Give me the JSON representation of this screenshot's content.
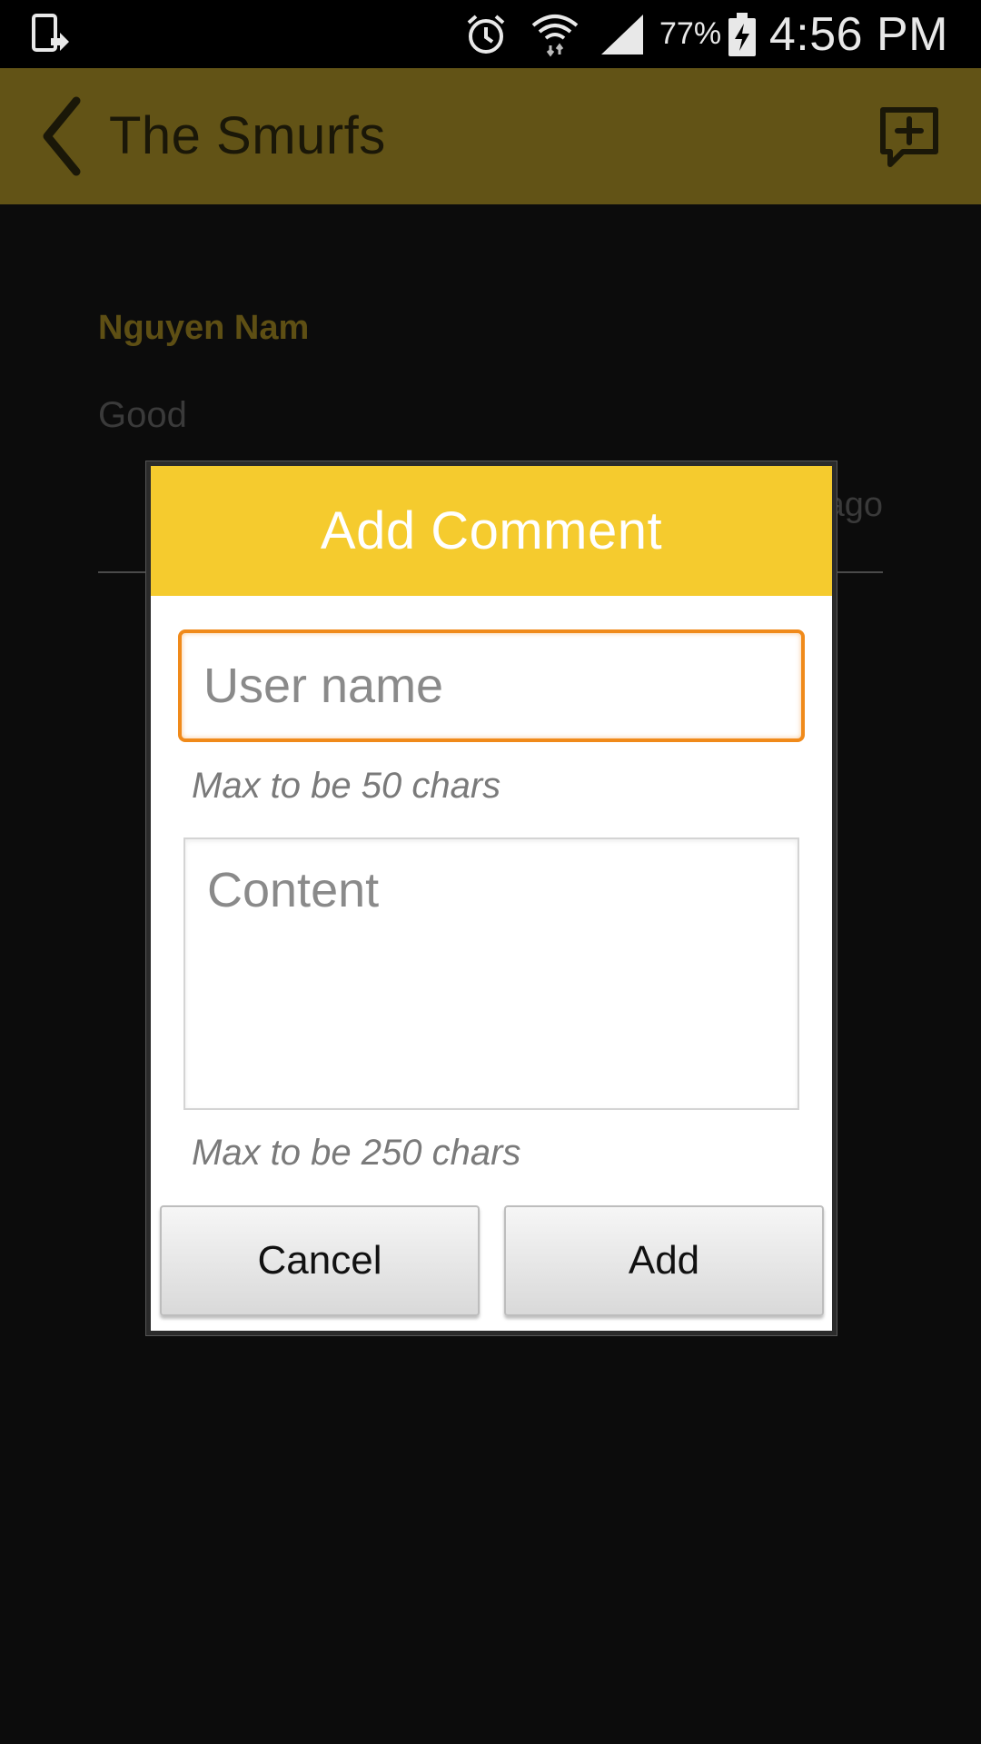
{
  "status_bar": {
    "battery_percent": "77%",
    "time": "4:56 PM",
    "icons": [
      "screenshot-icon",
      "alarm-icon",
      "wifi-icon",
      "signal-icon",
      "battery-charging-icon"
    ]
  },
  "action_bar": {
    "title": "The Smurfs",
    "back_icon": "chevron-left-icon",
    "add_comment_icon": "add-comment-icon",
    "color": "#625316"
  },
  "comment": {
    "author": "Nguyen Nam",
    "text": "Good",
    "time_fragment": "ago"
  },
  "dialog": {
    "title": "Add Comment",
    "header_color": "#f5cb2e",
    "username": {
      "value": "",
      "placeholder": "User name",
      "hint": "Max to be 50 chars",
      "focus_color": "#f08a1a"
    },
    "content": {
      "value": "",
      "placeholder": "Content",
      "hint": "Max to be 250 chars"
    },
    "buttons": {
      "cancel": "Cancel",
      "add": "Add"
    }
  }
}
